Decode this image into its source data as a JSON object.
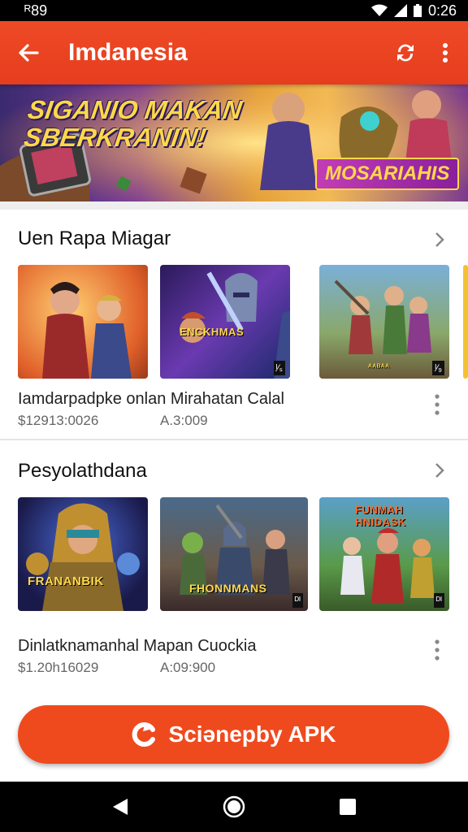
{
  "status": {
    "left": "ᴿ89",
    "time": "0:26"
  },
  "appbar": {
    "title": "Imdanesia",
    "back_icon": "arrow-left-icon",
    "sync_icon": "sync-icon",
    "menu_icon": "more-vert-icon"
  },
  "banner": {
    "title_line1": "SIGANIO MAKAN",
    "title_line2": "SBERKRANIN!",
    "badge": "MOSARIAHIS"
  },
  "sections": [
    {
      "title": "Uen Rapa Miagar",
      "thumbs": [
        {
          "label": "",
          "count": ""
        },
        {
          "label": "ENCKHMAS",
          "count": "ᴵ⁄ₛ"
        },
        {
          "label": "ᴬᴬᴮᴬᴬ",
          "count": "ᴵ⁄₉"
        }
      ],
      "item_title": "Iamdarpadpke onlan Mirahatan Calal",
      "item_sub_left": "$12913:0026",
      "item_sub_right": "A.3:009"
    },
    {
      "title": "Pesyolathdana",
      "thumbs": [
        {
          "label": "FRANANBIK",
          "count": ""
        },
        {
          "label": "FHONNMANS",
          "count": "ᴰᴵ"
        },
        {
          "label": "FUNMAH HNIDASK",
          "count": "ᴰᴵ"
        }
      ],
      "item_title": "Dinlatknamanhal Mapan Cuockia",
      "item_sub_left": "$1.20h16029",
      "item_sub_right": "A:09:900"
    }
  ],
  "cta": {
    "label": "Sciənepby APK",
    "icon": "c-logo-icon"
  },
  "colors": {
    "accent": "#ef4a1e",
    "appbar": "#e63d1e"
  }
}
